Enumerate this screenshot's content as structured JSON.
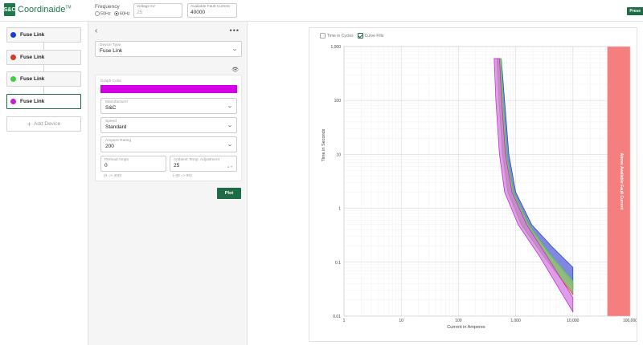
{
  "app": {
    "logo_mark": "S&C",
    "title": "Coordinaide",
    "trademark": "TM"
  },
  "header": {
    "frequency_label": "Frequency",
    "freq_50": "50Hz",
    "freq_60": "60Hz",
    "freq_selected": "60Hz",
    "voltage_label": "Voltage kV",
    "voltage_value": "25",
    "fault_label": "Available Fault Current",
    "fault_value": "40000",
    "corner_button": "Prese"
  },
  "devices": {
    "items": [
      {
        "label": "Fuse Link",
        "color": "#1a3fd6"
      },
      {
        "label": "Fuse Link",
        "color": "#d63a2a"
      },
      {
        "label": "Fuse Link",
        "color": "#3fcf3f"
      },
      {
        "label": "Fuse Link",
        "color": "#c41fd4"
      }
    ],
    "add_label": "Add Device"
  },
  "config": {
    "device_type_label": "Device Type",
    "device_type_value": "Fuse Link",
    "graph_color_label": "Graph Color",
    "graph_color": "#d400e5",
    "manufacturer_label": "Manufacturer",
    "manufacturer_value": "S&C",
    "speed_label": "Speed",
    "speed_value": "Standard",
    "ampere_label": "Ampere Rating",
    "ampere_value": "200",
    "preload_label": "Preload Amps",
    "preload_value": "0",
    "preload_hint": "(0 => 400)",
    "ambient_label": "Ambient Temp. Adjustment",
    "ambient_value": "25",
    "ambient_hint": "(-40 => 80)",
    "plot_button": "Plot"
  },
  "chart_options": {
    "time_in_cycles": "Time in Cycles",
    "curve_fills": "Curve Fills",
    "time_in_cycles_checked": false,
    "curve_fills_checked": true
  },
  "chart_data": {
    "type": "area",
    "xlabel": "Current in Amperes",
    "ylabel": "Time in Seconds",
    "xscale": "log",
    "yscale": "log",
    "xlim": [
      1,
      100000
    ],
    "ylim": [
      0.01,
      1000
    ],
    "x_ticks": [
      "1",
      "10",
      "100",
      "1,000",
      "10,000",
      "100,000"
    ],
    "y_ticks": [
      "1,000",
      "100",
      "10",
      "1",
      "0.1",
      "0.01"
    ],
    "band": {
      "label": "Above Available Fault Current",
      "from": 40000,
      "to": 100000,
      "color": "#f57f7f"
    },
    "series": [
      {
        "color": "#1a3fd6",
        "fill": "#5560d8",
        "min": [
          [
            470,
            600
          ],
          [
            520,
            100
          ],
          [
            600,
            10
          ],
          [
            750,
            2
          ],
          [
            1300,
            0.5
          ],
          [
            3000,
            0.15
          ],
          [
            10000,
            0.032
          ]
        ],
        "max": [
          [
            560,
            600
          ],
          [
            640,
            100
          ],
          [
            760,
            10
          ],
          [
            1000,
            2
          ],
          [
            1900,
            0.5
          ],
          [
            4200,
            0.2
          ],
          [
            10000,
            0.08
          ]
        ]
      },
      {
        "color": "#d63a2a",
        "fill": "#e07a62",
        "min": [
          [
            470,
            600
          ],
          [
            510,
            100
          ],
          [
            590,
            10
          ],
          [
            730,
            2
          ],
          [
            1250,
            0.5
          ],
          [
            2900,
            0.14
          ],
          [
            10000,
            0.025
          ]
        ],
        "max": [
          [
            550,
            600
          ],
          [
            600,
            100
          ],
          [
            690,
            10
          ],
          [
            900,
            2
          ],
          [
            1650,
            0.5
          ],
          [
            3700,
            0.15
          ],
          [
            10000,
            0.04
          ]
        ]
      },
      {
        "color": "#3fcf3f",
        "fill": "#7fd07f",
        "min": [
          [
            480,
            600
          ],
          [
            515,
            100
          ],
          [
            600,
            10
          ],
          [
            740,
            2
          ],
          [
            1280,
            0.5
          ],
          [
            2950,
            0.14
          ],
          [
            10000,
            0.028
          ]
        ],
        "max": [
          [
            560,
            600
          ],
          [
            610,
            100
          ],
          [
            700,
            10
          ],
          [
            920,
            2
          ],
          [
            1700,
            0.5
          ],
          [
            3800,
            0.15
          ],
          [
            10000,
            0.045
          ]
        ]
      },
      {
        "color": "#c41fd4",
        "fill": "#d47ee0",
        "min": [
          [
            420,
            600
          ],
          [
            450,
            100
          ],
          [
            520,
            10
          ],
          [
            640,
            2
          ],
          [
            1100,
            0.5
          ],
          [
            2600,
            0.13
          ],
          [
            10000,
            0.012
          ]
        ],
        "max": [
          [
            520,
            600
          ],
          [
            570,
            100
          ],
          [
            660,
            10
          ],
          [
            860,
            2
          ],
          [
            1550,
            0.5
          ],
          [
            3500,
            0.13
          ],
          [
            10000,
            0.022
          ]
        ]
      }
    ]
  }
}
